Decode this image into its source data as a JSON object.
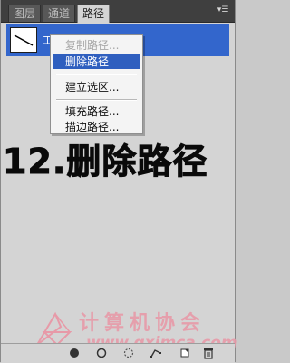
{
  "tabs": [
    {
      "label": "图层"
    },
    {
      "label": "通道"
    },
    {
      "label": "路径"
    }
  ],
  "path_list": {
    "selected_path_name": "工作路径"
  },
  "context_menu": {
    "items": [
      {
        "label": "复制路径...",
        "state": "disabled"
      },
      {
        "label": "删除路径",
        "state": "highlighted"
      },
      {
        "label": "建立选区...",
        "state": "normal"
      },
      {
        "label": "填充路径...",
        "state": "normal"
      },
      {
        "label": "描边路径...",
        "state": "normal"
      }
    ]
  },
  "caption": "12.删除路径",
  "watermark": {
    "title": "计算机协会",
    "url": "www.gxjmca.com"
  },
  "toolbar": {
    "icons": [
      "fill-path-icon",
      "stroke-path-icon",
      "load-selection-icon",
      "make-work-path-icon",
      "new-path-icon",
      "delete-path-icon"
    ]
  },
  "colors": {
    "selection": "#3366cc",
    "menu_highlight": "#2f5fbf",
    "watermark": "#e79aa8"
  }
}
